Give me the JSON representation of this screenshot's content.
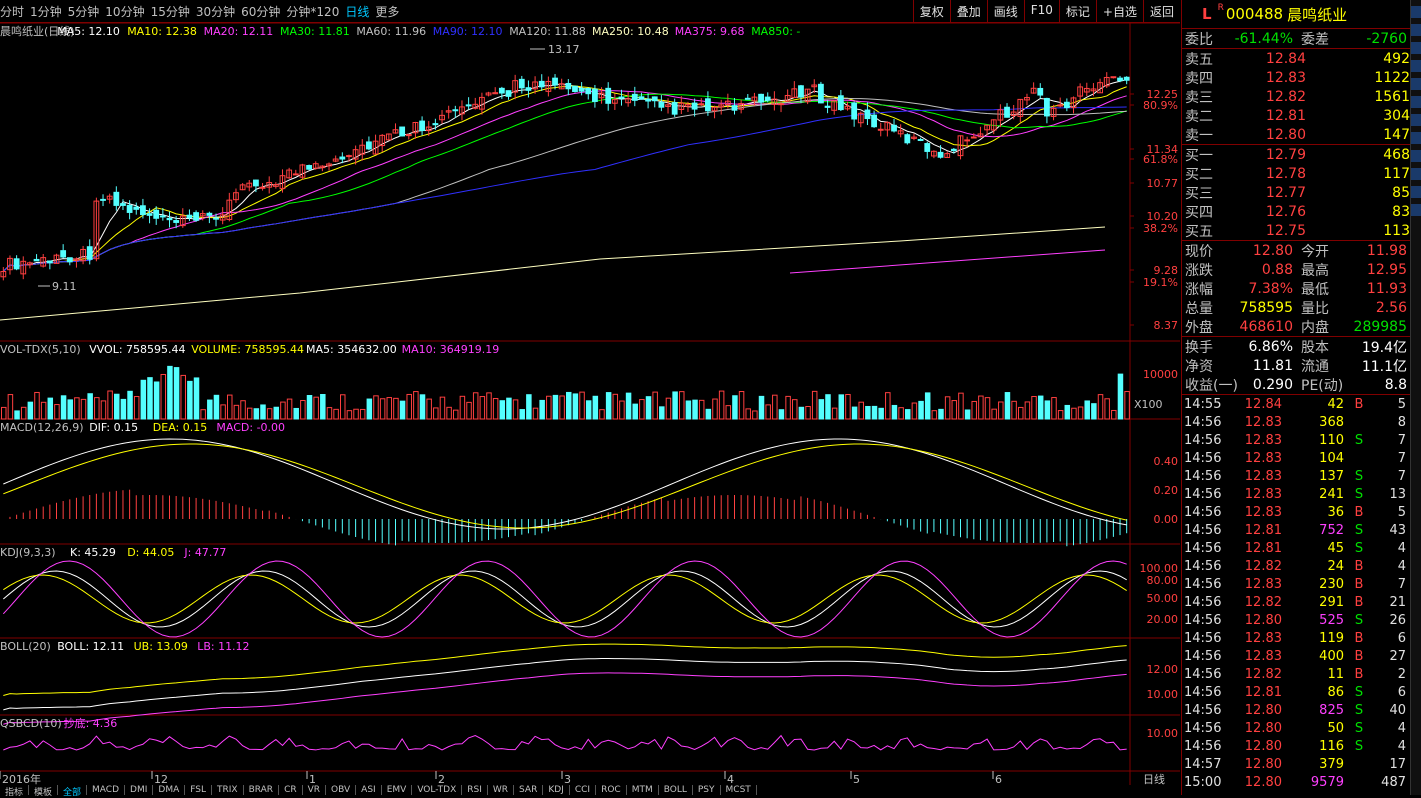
{
  "toolbar": {
    "tabs": [
      "分时",
      "1分钟",
      "5分钟",
      "10分钟",
      "15分钟",
      "30分钟",
      "60分钟",
      "分钟*120",
      "日线",
      "更多"
    ],
    "active_tab": "日线",
    "buttons": [
      "复权",
      "叠加",
      "画线",
      "F10",
      "标记",
      "+自选",
      "返回"
    ]
  },
  "colors": {
    "up": "#ff4040",
    "down": "#54ffff",
    "ma5": "#ffffff",
    "ma10": "#ffff00",
    "ma20": "#ff40ff",
    "ma30": "#00ff00",
    "ma60": "#c0c0c0",
    "ma90": "#3030ff",
    "ma250": "#ffffc0",
    "ma375": "#ff40ff",
    "grid": "#800000"
  },
  "main": {
    "header": {
      "name": "晨鸣纸业(日线)",
      "ma5": "MA5: 12.10",
      "ma10": "MA10: 12.38",
      "ma20": "MA20: 12.11",
      "ma30": "MA30: 11.81",
      "ma60": "MA60: 11.96",
      "ma90": "MA90: 12.10",
      "ma120": "MA120: 11.88",
      "ma250": "MA250: 10.48",
      "ma375": "MA375: 9.68",
      "ma850": "MA850: -"
    },
    "axis_labels": [
      "12.25",
      "80.9%",
      "11.34",
      "61.8%",
      "10.77",
      "10.20",
      "38.2%",
      "9.28",
      "19.1%",
      "8.37"
    ],
    "annot_high": "13.17",
    "annot_low": "9.11"
  },
  "vol": {
    "header": {
      "name": "VOL-TDX(5,10)",
      "vvol": "VVOL: 758595.44",
      "volume": "VOLUME: 758595.44",
      "ma5": "MA5: 354632.00",
      "ma10": "MA10: 364919.19"
    },
    "axis": "10000",
    "unit": "X100"
  },
  "macd": {
    "header": {
      "name": "MACD(12,26,9)",
      "dif": "DIF: 0.15",
      "dea": "DEA: 0.15",
      "macd": "MACD: -0.00"
    },
    "axis": [
      "0.40",
      "0.20",
      "0.00"
    ]
  },
  "kdj": {
    "header": {
      "name": "KDJ(9,3,3)",
      "k": "K: 45.29",
      "d": "D: 44.05",
      "j": "J: 47.77"
    },
    "axis": [
      "100.00",
      "80.00",
      "50.00",
      "20.00"
    ]
  },
  "boll": {
    "header": {
      "name": "BOLL(20)",
      "boll": "BOLL: 12.11",
      "ub": "UB: 13.09",
      "lb": "LB: 11.12"
    },
    "axis": [
      "12.00",
      "10.00"
    ]
  },
  "qsbcd": {
    "header": {
      "name": "QSBCD(10)",
      "val": "抄底: 4.36"
    },
    "axis": "10.00"
  },
  "xaxis": {
    "labels": [
      "2016年",
      "12",
      "1",
      "2",
      "3",
      "4",
      "5",
      "6"
    ],
    "period": "日线"
  },
  "bottom_tabs": [
    "指标",
    "模板",
    "全部",
    "MACD",
    "DMI",
    "DMA",
    "FSL",
    "TRIX",
    "BRAR",
    "CR",
    "VR",
    "OBV",
    "ASI",
    "EMV",
    "VOL-TDX",
    "RSI",
    "WR",
    "SAR",
    "KDJ",
    "CCI",
    "ROC",
    "MTM",
    "BOLL",
    "PSY",
    "MCST"
  ],
  "stock": {
    "flag": "L",
    "badge": "R",
    "code": "000488",
    "name": "晨鸣纸业"
  },
  "weibi": {
    "l1": "委比",
    "v1": "-61.44%",
    "l2": "委差",
    "v2": "-2760"
  },
  "asks": [
    {
      "label": "卖五",
      "price": "12.84",
      "vol": "492"
    },
    {
      "label": "卖四",
      "price": "12.83",
      "vol": "1122"
    },
    {
      "label": "卖三",
      "price": "12.82",
      "vol": "1561"
    },
    {
      "label": "卖二",
      "price": "12.81",
      "vol": "304"
    },
    {
      "label": "卖一",
      "price": "12.80",
      "vol": "147"
    }
  ],
  "bids": [
    {
      "label": "买一",
      "price": "12.79",
      "vol": "468"
    },
    {
      "label": "买二",
      "price": "12.78",
      "vol": "117"
    },
    {
      "label": "买三",
      "price": "12.77",
      "vol": "85"
    },
    {
      "label": "买四",
      "price": "12.76",
      "vol": "83"
    },
    {
      "label": "买五",
      "price": "12.75",
      "vol": "113"
    }
  ],
  "quote": [
    {
      "l1": "现价",
      "v1": "12.80",
      "c1": "red",
      "l2": "今开",
      "v2": "11.98",
      "c2": "red"
    },
    {
      "l1": "涨跌",
      "v1": "0.88",
      "c1": "red",
      "l2": "最高",
      "v2": "12.95",
      "c2": "red"
    },
    {
      "l1": "涨幅",
      "v1": "7.38%",
      "c1": "red",
      "l2": "最低",
      "v2": "11.93",
      "c2": "red"
    },
    {
      "l1": "总量",
      "v1": "758595",
      "c1": "yel",
      "l2": "量比",
      "v2": "2.56",
      "c2": "red"
    },
    {
      "l1": "外盘",
      "v1": "468610",
      "c1": "red",
      "l2": "内盘",
      "v2": "289985",
      "c2": "green"
    }
  ],
  "fund": [
    {
      "l1": "换手",
      "v1": "6.86%",
      "l2": "股本",
      "v2": "19.4亿"
    },
    {
      "l1": "净资",
      "v1": "11.81",
      "l2": "流通",
      "v2": "11.1亿"
    },
    {
      "l1": "收益(一)",
      "v1": "0.290",
      "l2": "PE(动)",
      "v2": "8.8"
    }
  ],
  "ticks": [
    {
      "t": "14:55",
      "p": "12.84",
      "q": "42",
      "bs": "B",
      "n": "5"
    },
    {
      "t": "14:56",
      "p": "12.83",
      "q": "368",
      "bs": "",
      "n": "8"
    },
    {
      "t": "14:56",
      "p": "12.83",
      "q": "110",
      "bs": "S",
      "n": "7"
    },
    {
      "t": "14:56",
      "p": "12.83",
      "q": "104",
      "bs": "",
      "n": "7"
    },
    {
      "t": "14:56",
      "p": "12.83",
      "q": "137",
      "bs": "S",
      "n": "7"
    },
    {
      "t": "14:56",
      "p": "12.83",
      "q": "241",
      "bs": "S",
      "n": "13"
    },
    {
      "t": "14:56",
      "p": "12.83",
      "q": "36",
      "bs": "B",
      "n": "5"
    },
    {
      "t": "14:56",
      "p": "12.81",
      "q": "752",
      "bs": "S",
      "n": "43",
      "mag": true
    },
    {
      "t": "14:56",
      "p": "12.81",
      "q": "45",
      "bs": "S",
      "n": "4"
    },
    {
      "t": "14:56",
      "p": "12.82",
      "q": "24",
      "bs": "B",
      "n": "4"
    },
    {
      "t": "14:56",
      "p": "12.83",
      "q": "230",
      "bs": "B",
      "n": "7"
    },
    {
      "t": "14:56",
      "p": "12.82",
      "q": "291",
      "bs": "B",
      "n": "21"
    },
    {
      "t": "14:56",
      "p": "12.80",
      "q": "525",
      "bs": "S",
      "n": "26",
      "mag": true
    },
    {
      "t": "14:56",
      "p": "12.83",
      "q": "119",
      "bs": "B",
      "n": "6"
    },
    {
      "t": "14:56",
      "p": "12.83",
      "q": "400",
      "bs": "B",
      "n": "27"
    },
    {
      "t": "14:56",
      "p": "12.82",
      "q": "11",
      "bs": "B",
      "n": "2"
    },
    {
      "t": "14:56",
      "p": "12.81",
      "q": "86",
      "bs": "S",
      "n": "6"
    },
    {
      "t": "14:56",
      "p": "12.80",
      "q": "825",
      "bs": "S",
      "n": "40",
      "mag": true
    },
    {
      "t": "14:56",
      "p": "12.80",
      "q": "50",
      "bs": "S",
      "n": "4"
    },
    {
      "t": "14:56",
      "p": "12.80",
      "q": "116",
      "bs": "S",
      "n": "4"
    },
    {
      "t": "14:57",
      "p": "12.80",
      "q": "379",
      "bs": "",
      "n": "17"
    },
    {
      "t": "15:00",
      "p": "12.80",
      "q": "9579",
      "bs": "",
      "n": "487",
      "mag": true
    }
  ]
}
